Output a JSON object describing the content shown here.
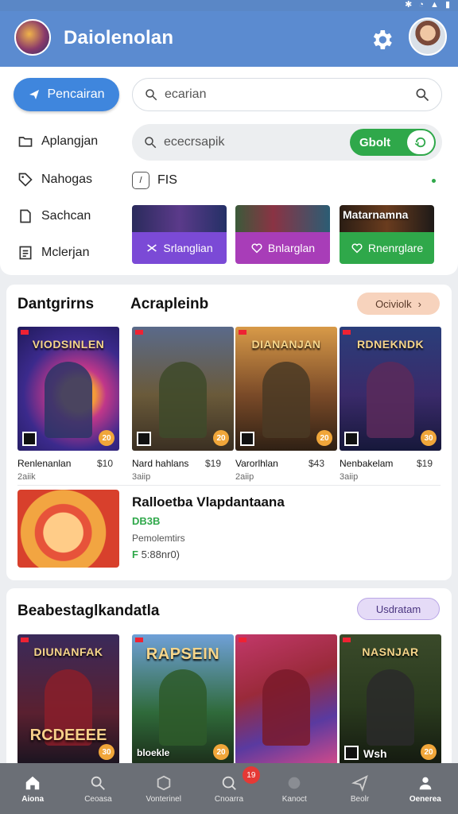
{
  "app": {
    "title": "Daiolenolan",
    "colors": {
      "primary": "#5b8bd0",
      "accent_blue": "#3f86dd",
      "green": "#2fa84a",
      "purple": "#7b4ad6",
      "magenta": "#a83db8"
    }
  },
  "actions": {
    "primary_button": "Pencairan"
  },
  "search": {
    "query": "ecarian",
    "secondary_query": "ececrsapik",
    "toggle_label": "Gbolt"
  },
  "sidebar": {
    "items": [
      {
        "label": "Aplangjan",
        "icon": "folder-icon"
      },
      {
        "label": "Nahogas",
        "icon": "tag-icon"
      },
      {
        "label": "Sachcan",
        "icon": "document-icon"
      },
      {
        "label": "Mclerjan",
        "icon": "list-icon"
      }
    ]
  },
  "filter": {
    "label": "FIS"
  },
  "promos": [
    {
      "label": "Srlanglian",
      "color": "#7b4ad6",
      "icon": "shuffle-icon"
    },
    {
      "label": "Bnlarglan",
      "color": "#a83db8",
      "icon": "heart-icon"
    },
    {
      "label": "Rnenrglare",
      "color": "#2fa84a",
      "icon": "heart-icon",
      "caption": "Matarnamna"
    }
  ],
  "section1": {
    "title_left": "Dantgrirns",
    "title_right": "Acrapleinb",
    "pill": "Ociviolk",
    "games": [
      {
        "cover_title": "VIODSINLEN",
        "name": "Renlenanlan",
        "price": "$10",
        "sub": "2aiik",
        "badge": "20"
      },
      {
        "cover_title": "",
        "name": "Nard hahlans",
        "price": "$19",
        "sub": "3aiip",
        "badge": "20"
      },
      {
        "cover_title": "DIANANJAN",
        "name": "Varorlhlan",
        "price": "$43",
        "sub": "2aiip",
        "badge": "20"
      },
      {
        "cover_title": "RDNEKNDK",
        "name": "Nenbakelam",
        "price": "$19",
        "sub": "3aiip",
        "badge": "30"
      }
    ],
    "featured": {
      "title": "Ralloetba Vlapdantaana",
      "tag": "DB3B",
      "subtitle": "Pemolemtirs",
      "meta_prefix": "F",
      "meta": "5:88nr0)"
    }
  },
  "section2": {
    "title": "Beabestaglkandatla",
    "pill": "Usdratam",
    "games": [
      {
        "cover_title": "DIUNANFAK",
        "badge": "30",
        "bottom_text": "RCDEEEE"
      },
      {
        "cover_title": "RAPSEIN",
        "badge": "20",
        "bottom_text": "bloekle"
      },
      {
        "cover_title": "",
        "badge": "",
        "bottom_text": ""
      },
      {
        "cover_title": "NASNJAR",
        "badge": "20",
        "bottom_text": "Wsh"
      }
    ]
  },
  "nav": [
    {
      "label": "Aiona",
      "icon": "home-icon",
      "active": true
    },
    {
      "label": "Ceoasa",
      "icon": "search-icon"
    },
    {
      "label": "Vonterinel",
      "icon": "cube-icon"
    },
    {
      "label": "Cnoarra",
      "icon": "chat-icon",
      "badge": "19"
    },
    {
      "label": "Kanoct",
      "icon": "circle-icon"
    },
    {
      "label": "Beolr",
      "icon": "send-icon"
    },
    {
      "label": "Oenerea",
      "icon": "user-icon",
      "active": true
    }
  ]
}
